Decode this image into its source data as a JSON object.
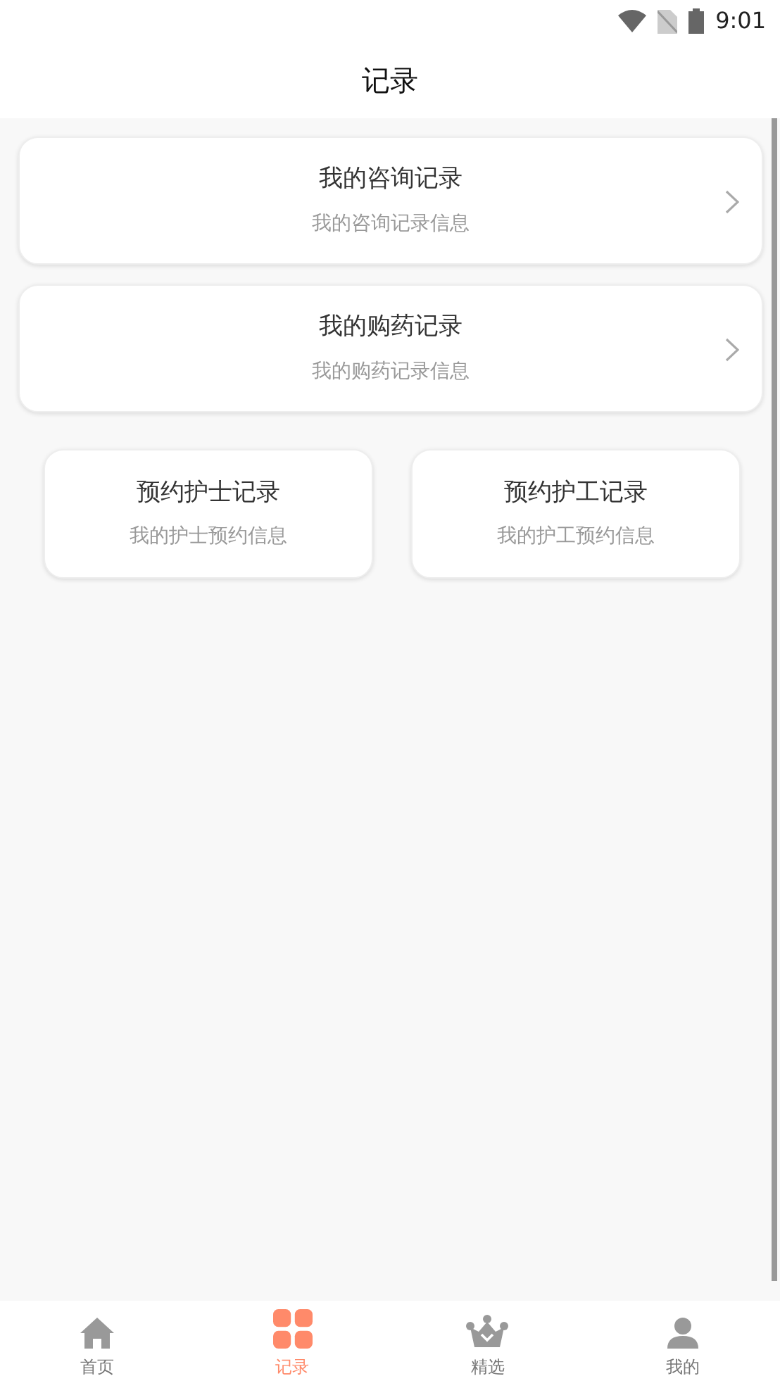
{
  "status_bar": {
    "time": "9:01"
  },
  "header": {
    "title": "记录"
  },
  "records": [
    {
      "title": "我的咨询记录",
      "subtitle": "我的咨询记录信息",
      "kind": "wide"
    },
    {
      "title": "我的购药记录",
      "subtitle": "我的购药记录信息",
      "kind": "wide"
    },
    {
      "title": "预约护士记录",
      "subtitle": "我的护士预约信息",
      "kind": "half"
    },
    {
      "title": "预约护工记录",
      "subtitle": "我的护工预约信息",
      "kind": "half"
    }
  ],
  "tab_bar": [
    {
      "label": "首页",
      "kind": "home",
      "selected": false
    },
    {
      "label": "记录",
      "kind": "grid",
      "selected": true
    },
    {
      "label": "精选",
      "kind": "crown",
      "selected": false
    },
    {
      "label": "我的",
      "kind": "person",
      "selected": false
    }
  ]
}
